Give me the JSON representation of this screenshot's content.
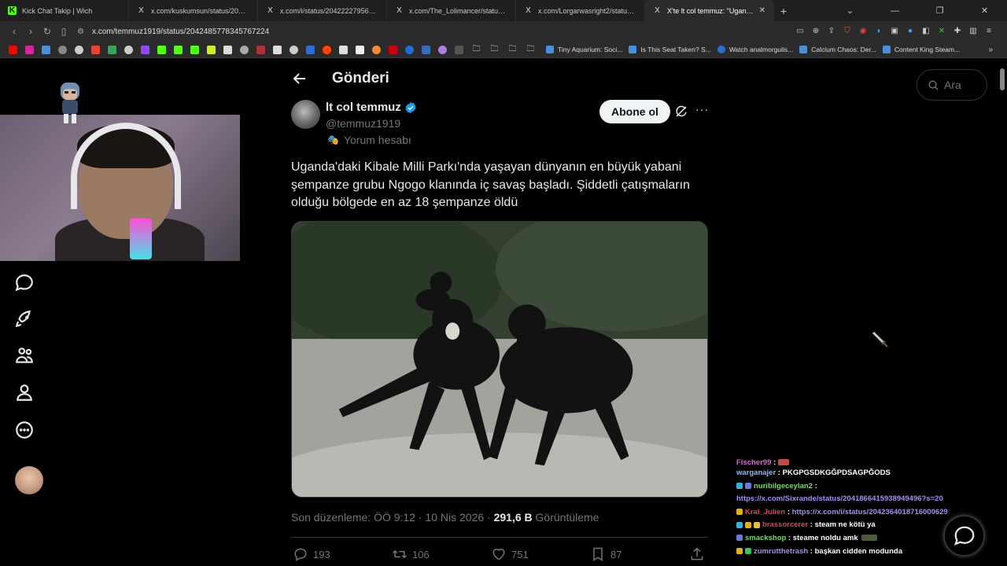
{
  "browser": {
    "tabs": [
      {
        "title": "Kick Chat Takip | Wich",
        "icon": "K"
      },
      {
        "title": "x.com/kuskumsun/status/20425426...",
        "icon": "X"
      },
      {
        "title": "x.com/i/status/20422227956653508...",
        "icon": "X"
      },
      {
        "title": "x.com/The_Lolimancer/status/20421...",
        "icon": "X"
      },
      {
        "title": "x.com/Lorgarwasright2/status/2042...",
        "icon": "X"
      },
      {
        "title": "X'te lt col temmuz: \"Uganda'daki...",
        "icon": "X"
      }
    ],
    "new_tab": "+",
    "url": "x.com/temmuz1919/status/2042485778345767224",
    "bookmarks": [
      {
        "label": "Tiny Aquarium: Soci..."
      },
      {
        "label": "Is This Seat Taken? S..."
      },
      {
        "label": "Watch analmorgulis..."
      },
      {
        "label": "Calcium Chaos: Der..."
      },
      {
        "label": "Content King Steam..."
      }
    ]
  },
  "header": {
    "title": "Gönderi"
  },
  "post": {
    "author_name": "lt col temmuz",
    "author_handle": "@temmuz1919",
    "author_label": "Yorum hesabı",
    "subscribe_label": "Abone ol",
    "text": "Uganda'daki Kibale Milli Parkı'nda yaşayan dünyanın en büyük yabani şempanze grubu Ngogo klanında iç savaş başladı. Şiddetli çatışmaların olduğu bölgede en az 18 şempanze öldü",
    "meta_prefix": "Son düzenleme: ÖÖ 9:12 · 10 Nis 2026 · ",
    "views_count": "291,6 B",
    "views_label": " Görüntüleme",
    "replies": "193",
    "reposts": "106",
    "likes": "751",
    "bookmarks": "87"
  },
  "search": {
    "placeholder": "Ara"
  },
  "chat": [
    {
      "user": "Fischer99",
      "msg": "",
      "color": "#d46fd4"
    },
    {
      "user": "warganajer",
      "msg": "PKGPGSDKGĞPDSAGPĞODS",
      "color": "#8fb8ff"
    },
    {
      "user": "nuribilgeceylan2",
      "msg": "",
      "color": "#7ad66b"
    },
    {
      "user": "",
      "msg": "https://x.com/Sixrande/status/2041866415938949496?s=20",
      "color": "#a98cf0",
      "link": true
    },
    {
      "user": "Kral_Julien",
      "msg": "https://x.com/i/status/2042364018716000629",
      "color": "#e0454a",
      "link": true
    },
    {
      "user": "brassorcerer",
      "msg": "steam ne kötü ya",
      "color": "#e0454a"
    },
    {
      "user": "smackshop",
      "msg": "steame noldu amk",
      "color": "#7ad66b"
    },
    {
      "user": "zumrutthetrash",
      "msg": "başkan cidden modunda",
      "color": "#a98cf0"
    }
  ],
  "colors": {
    "background": "#000000",
    "text_primary": "#e7e9ea",
    "text_secondary": "#71767b",
    "verified": "#1d9bf0",
    "border": "#2f3336"
  }
}
